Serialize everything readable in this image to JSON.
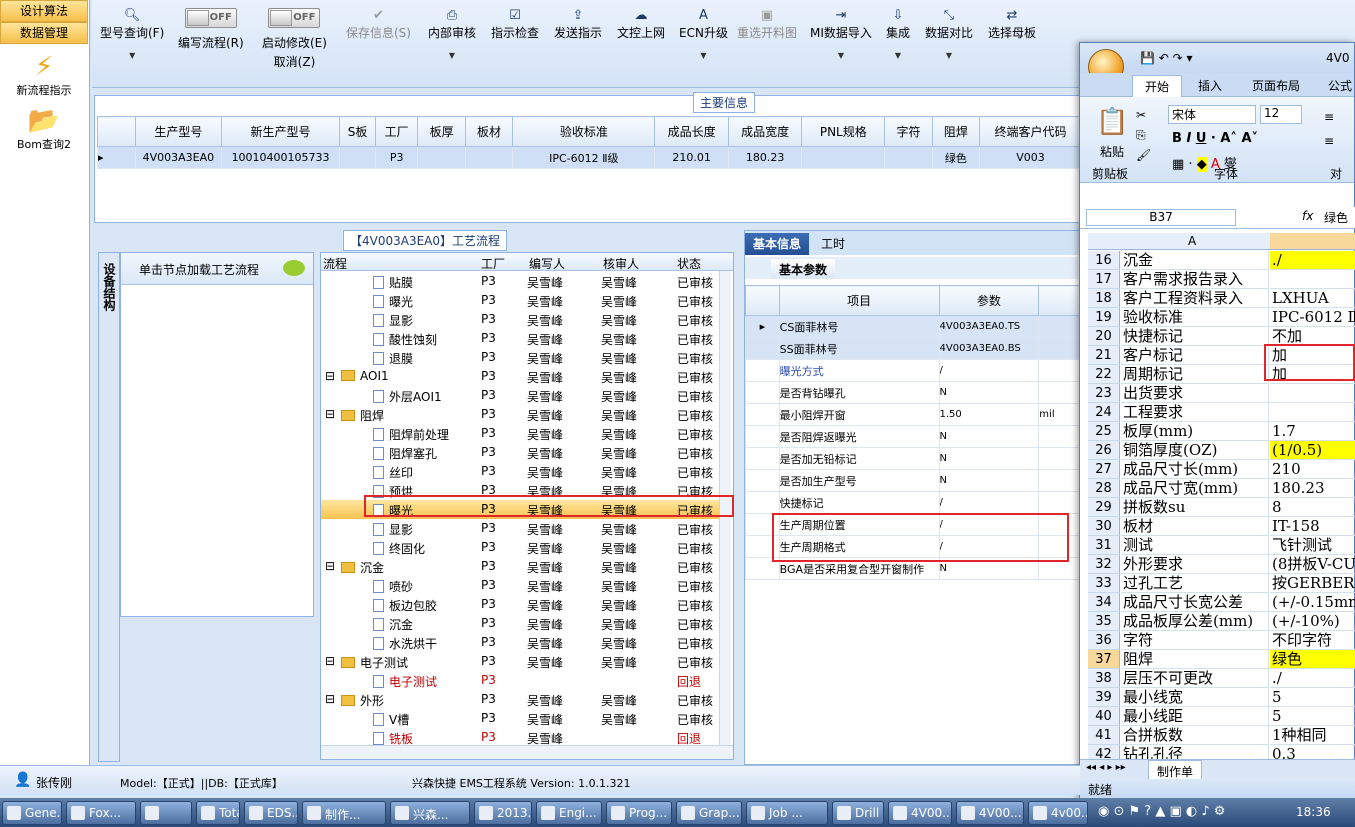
{
  "leftnav": {
    "btn1": "设计算法",
    "btn2": "数据管理",
    "tool1": "新流程指示",
    "tool2": "Bom查询2"
  },
  "toolbar": {
    "items": [
      {
        "label": "型号查询(F)",
        "icon": "search-icon"
      },
      {
        "label": "编写流程(R)",
        "toggle": "OFF"
      },
      {
        "label": "启动修改(E)",
        "sub": "取消(Z)",
        "toggle": "OFF"
      },
      {
        "label": "保存信息(S)",
        "icon": "check-icon",
        "disabled": true
      },
      {
        "label": "内部审核",
        "icon": "printer-icon"
      },
      {
        "label": "指示检查",
        "icon": "check-box-icon"
      },
      {
        "label": "发送指示",
        "icon": "upload-icon"
      },
      {
        "label": "文控上网",
        "icon": "cloud-icon"
      },
      {
        "label": "ECN升级",
        "icon": "ecn-icon"
      },
      {
        "label": "重选开料图",
        "icon": "image-icon",
        "disabled": true
      },
      {
        "label": "MI数据导入",
        "icon": "import-icon"
      },
      {
        "label": "集成",
        "icon": "download-icon"
      },
      {
        "label": "数据对比",
        "icon": "compare-icon"
      },
      {
        "label": "选择母板",
        "icon": "shuffle-icon"
      }
    ]
  },
  "main_info": {
    "title": "主要信息",
    "headers": [
      "生产型号",
      "新生产型号",
      "S板",
      "工厂",
      "板厚",
      "板材",
      "验收标准",
      "成品长度",
      "成品宽度",
      "PNL规格",
      "字符",
      "阻焊",
      "终端客户代码"
    ],
    "row": [
      "4V003A3EA0",
      "10010400105733",
      "",
      "P3",
      "",
      "",
      "IPC-6012 Ⅱ级",
      "210.01",
      "180.23",
      "",
      "",
      "绿色",
      "V003"
    ]
  },
  "side_tab": "设备结构",
  "node_panel": {
    "header": "单击节点加载工艺流程"
  },
  "flow": {
    "title": "【4V003A3EA0】工艺流程",
    "headers": [
      "流程",
      "工厂",
      "编写人",
      "核审人",
      "状态"
    ],
    "rows": [
      {
        "name": "贴膜",
        "level": 2,
        "factory": "P3",
        "writer": "吴雪峰",
        "reviewer": "吴雪峰",
        "status": "已审核"
      },
      {
        "name": "曝光",
        "level": 2,
        "factory": "P3",
        "writer": "吴雪峰",
        "reviewer": "吴雪峰",
        "status": "已审核"
      },
      {
        "name": "显影",
        "level": 2,
        "factory": "P3",
        "writer": "吴雪峰",
        "reviewer": "吴雪峰",
        "status": "已审核"
      },
      {
        "name": "酸性蚀刻",
        "level": 2,
        "factory": "P3",
        "writer": "吴雪峰",
        "reviewer": "吴雪峰",
        "status": "已审核"
      },
      {
        "name": "退膜",
        "level": 2,
        "factory": "P3",
        "writer": "吴雪峰",
        "reviewer": "吴雪峰",
        "status": "已审核"
      },
      {
        "name": "AOI1",
        "level": 1,
        "factory": "P3",
        "writer": "吴雪峰",
        "reviewer": "吴雪峰",
        "status": "已审核"
      },
      {
        "name": "外层AOI1",
        "level": 2,
        "factory": "P3",
        "writer": "吴雪峰",
        "reviewer": "吴雪峰",
        "status": "已审核"
      },
      {
        "name": "阻焊",
        "level": 1,
        "factory": "P3",
        "writer": "吴雪峰",
        "reviewer": "吴雪峰",
        "status": "已审核"
      },
      {
        "name": "阻焊前处理",
        "level": 2,
        "factory": "P3",
        "writer": "吴雪峰",
        "reviewer": "吴雪峰",
        "status": "已审核"
      },
      {
        "name": "阻焊塞孔",
        "level": 2,
        "factory": "P3",
        "writer": "吴雪峰",
        "reviewer": "吴雪峰",
        "status": "已审核"
      },
      {
        "name": "丝印",
        "level": 2,
        "factory": "P3",
        "writer": "吴雪峰",
        "reviewer": "吴雪峰",
        "status": "已审核"
      },
      {
        "name": "预烘",
        "level": 2,
        "factory": "P3",
        "writer": "吴雪峰",
        "reviewer": "吴雪峰",
        "status": "已审核"
      },
      {
        "name": "曝光",
        "level": 2,
        "factory": "P3",
        "writer": "吴雪峰",
        "reviewer": "吴雪峰",
        "status": "已审核",
        "selected": true
      },
      {
        "name": "显影",
        "level": 2,
        "factory": "P3",
        "writer": "吴雪峰",
        "reviewer": "吴雪峰",
        "status": "已审核"
      },
      {
        "name": "终固化",
        "level": 2,
        "factory": "P3",
        "writer": "吴雪峰",
        "reviewer": "吴雪峰",
        "status": "已审核"
      },
      {
        "name": "沉金",
        "level": 1,
        "factory": "P3",
        "writer": "吴雪峰",
        "reviewer": "吴雪峰",
        "status": "已审核"
      },
      {
        "name": "喷砂",
        "level": 2,
        "factory": "P3",
        "writer": "吴雪峰",
        "reviewer": "吴雪峰",
        "status": "已审核"
      },
      {
        "name": "板边包胶",
        "level": 2,
        "factory": "P3",
        "writer": "吴雪峰",
        "reviewer": "吴雪峰",
        "status": "已审核"
      },
      {
        "name": "沉金",
        "level": 2,
        "factory": "P3",
        "writer": "吴雪峰",
        "reviewer": "吴雪峰",
        "status": "已审核"
      },
      {
        "name": "水洗烘干",
        "level": 2,
        "factory": "P3",
        "writer": "吴雪峰",
        "reviewer": "吴雪峰",
        "status": "已审核"
      },
      {
        "name": "电子测试",
        "level": 1,
        "factory": "P3",
        "writer": "吴雪峰",
        "reviewer": "吴雪峰",
        "status": "已审核"
      },
      {
        "name": "电子测试",
        "level": 2,
        "factory": "P3",
        "writer": "",
        "reviewer": "",
        "status": "回退",
        "red": true
      },
      {
        "name": "外形",
        "level": 1,
        "factory": "P3",
        "writer": "吴雪峰",
        "reviewer": "吴雪峰",
        "status": "已审核"
      },
      {
        "name": "V槽",
        "level": 2,
        "factory": "P3",
        "writer": "吴雪峰",
        "reviewer": "吴雪峰",
        "status": "已审核"
      },
      {
        "name": "铣板",
        "level": 2,
        "factory": "P3",
        "writer": "吴雪峰",
        "reviewer": "",
        "status": "回退",
        "red": true
      }
    ]
  },
  "basic": {
    "tab1": "基本信息",
    "tab2": "工时",
    "subtab": "基本参数",
    "headers": [
      "项目",
      "参数"
    ],
    "rows": [
      {
        "item": "CS面菲林号",
        "value": "4V003A3EA0.TS",
        "unit": ""
      },
      {
        "item": "SS面菲林号",
        "value": "4V003A3EA0.BS",
        "unit": ""
      },
      {
        "item": "曝光方式",
        "value": "/",
        "unit": "",
        "blue": true
      },
      {
        "item": "是否背钻曝孔",
        "value": "N",
        "unit": ""
      },
      {
        "item": "最小阻焊开窗",
        "value": "1.50",
        "unit": "mil"
      },
      {
        "item": "是否阻焊返曝光",
        "value": "N",
        "unit": ""
      },
      {
        "item": "是否加无铅标记",
        "value": "N",
        "unit": ""
      },
      {
        "item": "是否加生产型号",
        "value": "N",
        "unit": ""
      },
      {
        "item": "快捷标记",
        "value": "/",
        "unit": ""
      },
      {
        "item": "生产周期位置",
        "value": "/",
        "unit": ""
      },
      {
        "item": "生产周期格式",
        "value": "/",
        "unit": ""
      },
      {
        "item": "BGA是否采用复合型开窗制作",
        "value": "N",
        "unit": ""
      }
    ]
  },
  "excel": {
    "title": "4V0",
    "tabs": [
      "开始",
      "插入",
      "页面布局",
      "公式"
    ],
    "font_name": "宋体",
    "font_size": "12",
    "group_clipboard": "剪贴板",
    "group_font": "字体",
    "group_align": "对",
    "paste": "粘贴",
    "cell_ref": "B37",
    "formula_value": "绿色",
    "col_a": "A",
    "rows": [
      {
        "n": "16",
        "a": "沉金",
        "b": "./",
        "yel": true
      },
      {
        "n": "17",
        "a": "客户需求报告录入",
        "b": ""
      },
      {
        "n": "18",
        "a": "客户工程资料录入",
        "b": "LXHUA"
      },
      {
        "n": "19",
        "a": "验收标准",
        "b": "IPC-6012 Ⅱ"
      },
      {
        "n": "20",
        "a": "快捷标记",
        "b": "不加"
      },
      {
        "n": "21",
        "a": "客户标记",
        "b": "加"
      },
      {
        "n": "22",
        "a": "周期标记",
        "b": "加"
      },
      {
        "n": "23",
        "a": "出货要求",
        "b": ""
      },
      {
        "n": "24",
        "a": "工程要求",
        "b": ""
      },
      {
        "n": "25",
        "a": "板厚(mm)",
        "b": "1.7"
      },
      {
        "n": "26",
        "a": "铜箔厚度(OZ)",
        "b": "(1/0.5)",
        "yel": true
      },
      {
        "n": "27",
        "a": "成品尺寸长(mm)",
        "b": "210"
      },
      {
        "n": "28",
        "a": "成品尺寸宽(mm)",
        "b": "180.23"
      },
      {
        "n": "29",
        "a": "拼板数su",
        "b": "8"
      },
      {
        "n": "30",
        "a": "板材",
        "b": "IT-158"
      },
      {
        "n": "31",
        "a": "测试",
        "b": "飞针测试"
      },
      {
        "n": "32",
        "a": "外形要求",
        "b": "(8拼板V-CUT"
      },
      {
        "n": "33",
        "a": "过孔工艺",
        "b": "按GERBER文件"
      },
      {
        "n": "34",
        "a": "成品尺寸长宽公差",
        "b": "(+/-0.15mm)"
      },
      {
        "n": "35",
        "a": "成品板厚公差(mm)",
        "b": "(+/-10%)"
      },
      {
        "n": "36",
        "a": "字符",
        "b": "不印字符"
      },
      {
        "n": "37",
        "a": "阻焊",
        "b": "绿色",
        "yel": true,
        "sel": true
      },
      {
        "n": "38",
        "a": "层压不可更改",
        "b": "./"
      },
      {
        "n": "39",
        "a": "最小线宽",
        "b": "5"
      },
      {
        "n": "40",
        "a": "最小线距",
        "b": "5"
      },
      {
        "n": "41",
        "a": "合拼板数",
        "b": "1种相同"
      },
      {
        "n": "42",
        "a": "钻孔孔径",
        "b": "0.3"
      }
    ],
    "sheet_tab": "制作单",
    "status": "就绪"
  },
  "statusbar": {
    "user": "张传刚",
    "model": "Model:【正式】||DB:【正式库】",
    "system": "兴森快捷 EMS工程系统 Version: 1.0.1.321"
  },
  "taskbar": {
    "items": [
      "Gene...",
      "Fox...",
      "",
      "Total...",
      "EDS...",
      "制作...",
      "兴森...",
      "2013...",
      "Engi...",
      "Prog...",
      "Grap...",
      "Job ...",
      "Drill ...",
      "4V00...",
      "4V00...",
      "4v00..."
    ],
    "clock": "18:36"
  }
}
